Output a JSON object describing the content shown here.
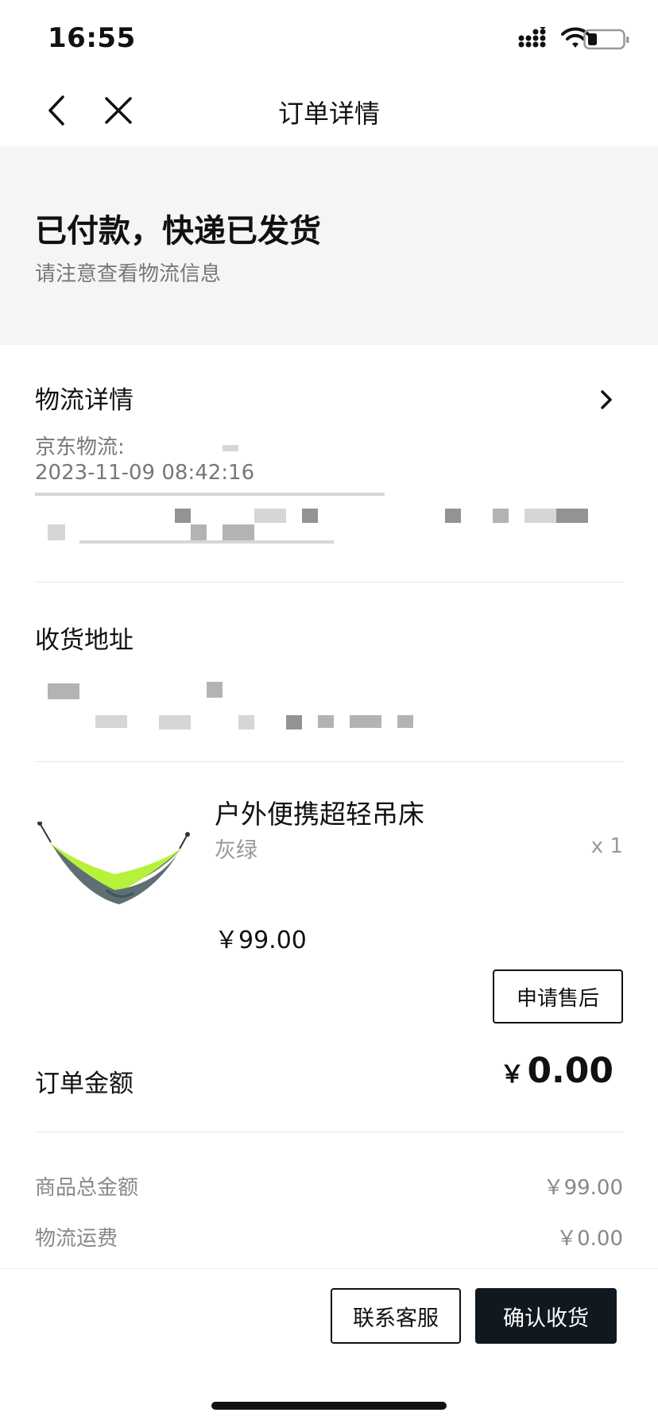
{
  "status_bar": {
    "time": "16:55"
  },
  "nav": {
    "title": "订单详情"
  },
  "banner": {
    "title": "已付款，快递已发货",
    "subtitle": "请注意查看物流信息"
  },
  "logistics": {
    "title": "物流详情",
    "carrier": "京东物流:",
    "timestamp": "2023-11-09 08:42:16"
  },
  "address": {
    "title": "收货地址"
  },
  "product": {
    "name": "户外便携超轻吊床",
    "spec": "灰绿",
    "quantity": "x 1",
    "price": "￥99.00",
    "after_sale_label": "申请售后",
    "image_colors": {
      "fabric_top": "#b6f23c",
      "fabric_bottom": "#5f6e72"
    }
  },
  "order": {
    "amount_label": "订单金额",
    "amount_currency": "￥",
    "amount_value": "0.00",
    "fees": [
      {
        "label": "商品总金额",
        "value": "￥99.00"
      },
      {
        "label": "物流运费",
        "value": "￥0.00"
      }
    ]
  },
  "actions": {
    "service_label": "联系客服",
    "confirm_label": "确认收货"
  },
  "colors": {
    "banner_bg": "#f5f5f5",
    "primary_button": "#101820",
    "muted_text": "#777777"
  }
}
